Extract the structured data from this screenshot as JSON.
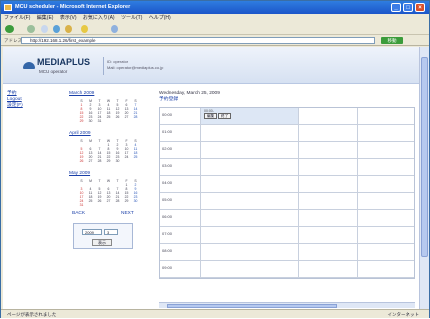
{
  "window": {
    "title": "MCU scheduler - Microsoft Internet Explorer"
  },
  "menu": [
    "ファイル(F)",
    "編集(E)",
    "表示(V)",
    "お気に入り(A)",
    "ツール(T)",
    "ヘルプ(H)"
  ],
  "address": {
    "label": "アドレス(D)",
    "url": "http://192.168.1.26/first_example",
    "go": "移動"
  },
  "header": {
    "logo": "MEDIAPLUS",
    "subtitle": "MCU operator",
    "login_line1": "ID: operator",
    "login_line2": "Mail: operator@mediaplus.co.jp"
  },
  "nav": [
    "予約",
    "Logout",
    "設定(F)"
  ],
  "calendars": [
    {
      "title": "March 2009",
      "rows": [
        [
          "S",
          "M",
          "T",
          "W",
          "T",
          "F",
          "S"
        ],
        [
          "1",
          "2",
          "3",
          "4",
          "5",
          "6",
          "7"
        ],
        [
          "8",
          "9",
          "10",
          "11",
          "12",
          "13",
          "14"
        ],
        [
          "15",
          "16",
          "17",
          "18",
          "19",
          "20",
          "21"
        ],
        [
          "22",
          "23",
          "24",
          "25",
          "26",
          "27",
          "28"
        ],
        [
          "29",
          "30",
          "31",
          "",
          "",
          "",
          ""
        ]
      ]
    },
    {
      "title": "April 2009",
      "rows": [
        [
          "S",
          "M",
          "T",
          "W",
          "T",
          "F",
          "S"
        ],
        [
          "",
          "",
          "",
          "1",
          "2",
          "3",
          "4"
        ],
        [
          "5",
          "6",
          "7",
          "8",
          "9",
          "10",
          "11"
        ],
        [
          "12",
          "13",
          "14",
          "15",
          "16",
          "17",
          "18"
        ],
        [
          "19",
          "20",
          "21",
          "22",
          "23",
          "24",
          "25"
        ],
        [
          "26",
          "27",
          "28",
          "29",
          "30",
          "",
          ""
        ]
      ]
    },
    {
      "title": "May 2009",
      "rows": [
        [
          "S",
          "M",
          "T",
          "W",
          "T",
          "F",
          "S"
        ],
        [
          "",
          "",
          "",
          "",
          "",
          "1",
          "2"
        ],
        [
          "3",
          "4",
          "5",
          "6",
          "7",
          "8",
          "9"
        ],
        [
          "10",
          "11",
          "12",
          "13",
          "14",
          "15",
          "16"
        ],
        [
          "17",
          "18",
          "19",
          "20",
          "21",
          "22",
          "23"
        ],
        [
          "24",
          "25",
          "26",
          "27",
          "28",
          "29",
          "30"
        ],
        [
          "31",
          "",
          "",
          "",
          "",
          "",
          ""
        ]
      ]
    }
  ],
  "calnav": {
    "prev": "BACK",
    "next": "NEXT"
  },
  "selector": {
    "year": "2009",
    "month": "3",
    "button": "表示"
  },
  "schedule": {
    "date": "Wednesday, March 25, 2009",
    "register": "予約登録",
    "times": [
      "00:00",
      "01:00",
      "02:00",
      "03:00",
      "04:00",
      "05:00",
      "06:00",
      "07:00",
      "08:00",
      "09:00"
    ],
    "event_label": "00:00-",
    "event_edit": "編集",
    "event_end": "終了"
  },
  "status": {
    "left": "ページが表示されました",
    "right": "インターネット"
  }
}
